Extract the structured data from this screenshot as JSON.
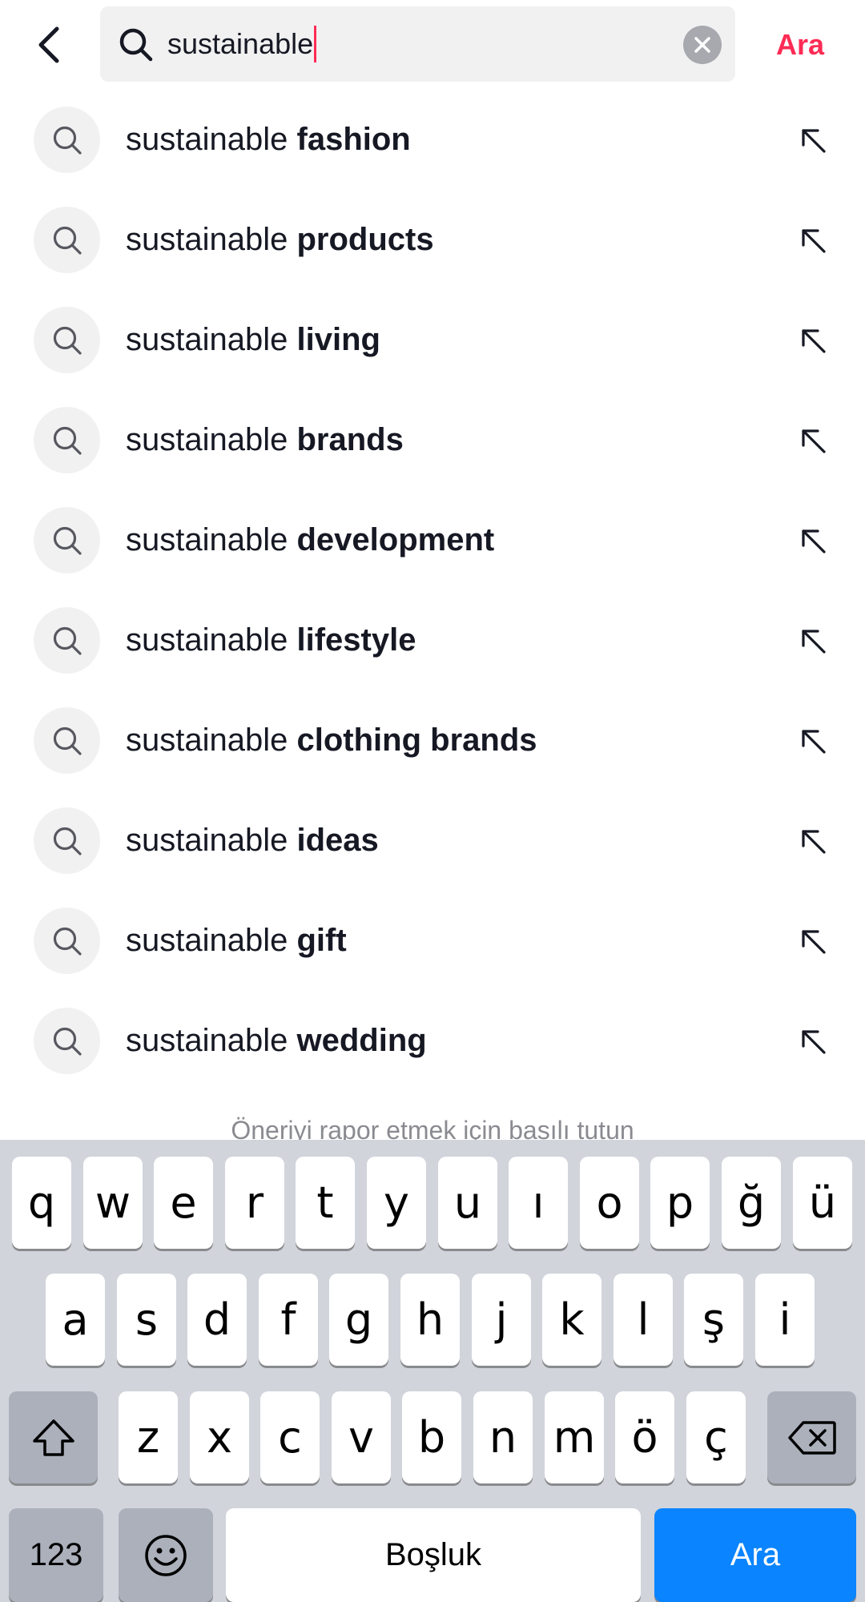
{
  "header": {
    "query": "sustainable",
    "action_label": "Ara"
  },
  "suggestions": [
    {
      "prefix": "sustainable",
      "completion": "fashion"
    },
    {
      "prefix": "sustainable",
      "completion": "products"
    },
    {
      "prefix": "sustainable",
      "completion": "living"
    },
    {
      "prefix": "sustainable",
      "completion": "brands"
    },
    {
      "prefix": "sustainable",
      "completion": "development"
    },
    {
      "prefix": "sustainable",
      "completion": "lifestyle"
    },
    {
      "prefix": "sustainable",
      "completion": "clothing brands"
    },
    {
      "prefix": "sustainable",
      "completion": "ideas"
    },
    {
      "prefix": "sustainable",
      "completion": "gift"
    },
    {
      "prefix": "sustainable",
      "completion": "wedding"
    }
  ],
  "hint": "Öneriyi rapor etmek için basılı tutun",
  "keyboard": {
    "row1": [
      "q",
      "w",
      "e",
      "r",
      "t",
      "y",
      "u",
      "ı",
      "o",
      "p",
      "ğ",
      "ü"
    ],
    "row2": [
      "a",
      "s",
      "d",
      "f",
      "g",
      "h",
      "j",
      "k",
      "l",
      "ş",
      "i"
    ],
    "row3": [
      "z",
      "x",
      "c",
      "v",
      "b",
      "n",
      "m",
      "ö",
      "ç"
    ],
    "numbers_label": "123",
    "space_label": "Boşluk",
    "return_label": "Ara"
  },
  "colors": {
    "accent": "#fe2c55",
    "keyboard_action": "#0a84ff",
    "search_field_bg": "#f1f1f2"
  },
  "icons": {
    "back": "chevron-left-icon",
    "search": "search-icon",
    "clear": "clear-x-icon",
    "fill_suggestion": "arrow-up-left-icon",
    "shift": "shift-icon",
    "backspace": "backspace-icon",
    "emoji": "emoji-icon"
  }
}
